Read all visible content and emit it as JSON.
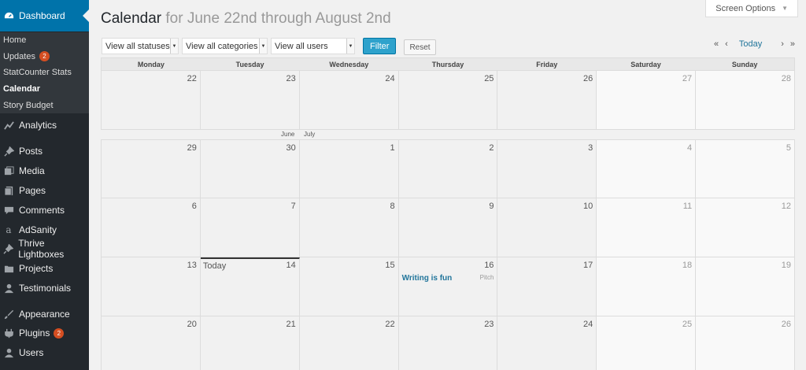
{
  "sidebar": {
    "dashboard": "Dashboard",
    "submenu": [
      {
        "label": "Home"
      },
      {
        "label": "Updates",
        "badge": "2"
      },
      {
        "label": "StatCounter Stats"
      },
      {
        "label": "Calendar",
        "current": true
      },
      {
        "label": "Story Budget"
      }
    ],
    "menu": [
      {
        "label": "Analytics",
        "icon": "chart-icon"
      },
      {
        "label": "Posts",
        "icon": "pin-icon"
      },
      {
        "label": "Media",
        "icon": "media-icon"
      },
      {
        "label": "Pages",
        "icon": "pages-icon"
      },
      {
        "label": "Comments",
        "icon": "comment-icon"
      },
      {
        "label": "AdSanity",
        "icon": "adsanity-icon"
      },
      {
        "label": "Thrive Lightboxes",
        "icon": "pin-icon"
      },
      {
        "label": "Projects",
        "icon": "folder-icon"
      },
      {
        "label": "Testimonials",
        "icon": "user-icon"
      },
      {
        "label": "Appearance",
        "icon": "brush-icon"
      },
      {
        "label": "Plugins",
        "icon": "plugin-icon",
        "badge": "2"
      },
      {
        "label": "Users",
        "icon": "user-icon"
      }
    ]
  },
  "header": {
    "title": "Calendar",
    "range": "for June 22nd through August 2nd",
    "screen_options": "Screen Options"
  },
  "filters": {
    "status": "View all statuses",
    "category": "View all categories",
    "user": "View all users",
    "filter_button": "Filter",
    "reset_button": "Reset"
  },
  "pager": {
    "first": "«",
    "prev": "‹",
    "today": "Today",
    "next": "›",
    "last": "»"
  },
  "calendar": {
    "days": [
      "Monday",
      "Tuesday",
      "Wednesday",
      "Thursday",
      "Friday",
      "Saturday",
      "Sunday"
    ],
    "month_labels": {
      "june": "June",
      "july": "July"
    },
    "weeks": [
      [
        "22",
        "23",
        "24",
        "25",
        "26",
        "27",
        "28"
      ],
      [
        "29",
        "30",
        "1",
        "2",
        "3",
        "4",
        "5"
      ],
      [
        "6",
        "7",
        "8",
        "9",
        "10",
        "11",
        "12"
      ],
      [
        "13",
        "14",
        "15",
        "16",
        "17",
        "18",
        "19"
      ],
      [
        "20",
        "21",
        "22",
        "23",
        "24",
        "25",
        "26"
      ]
    ],
    "today_label": "Today",
    "post": {
      "title": "Writing is fun",
      "status": "Pitch"
    }
  }
}
